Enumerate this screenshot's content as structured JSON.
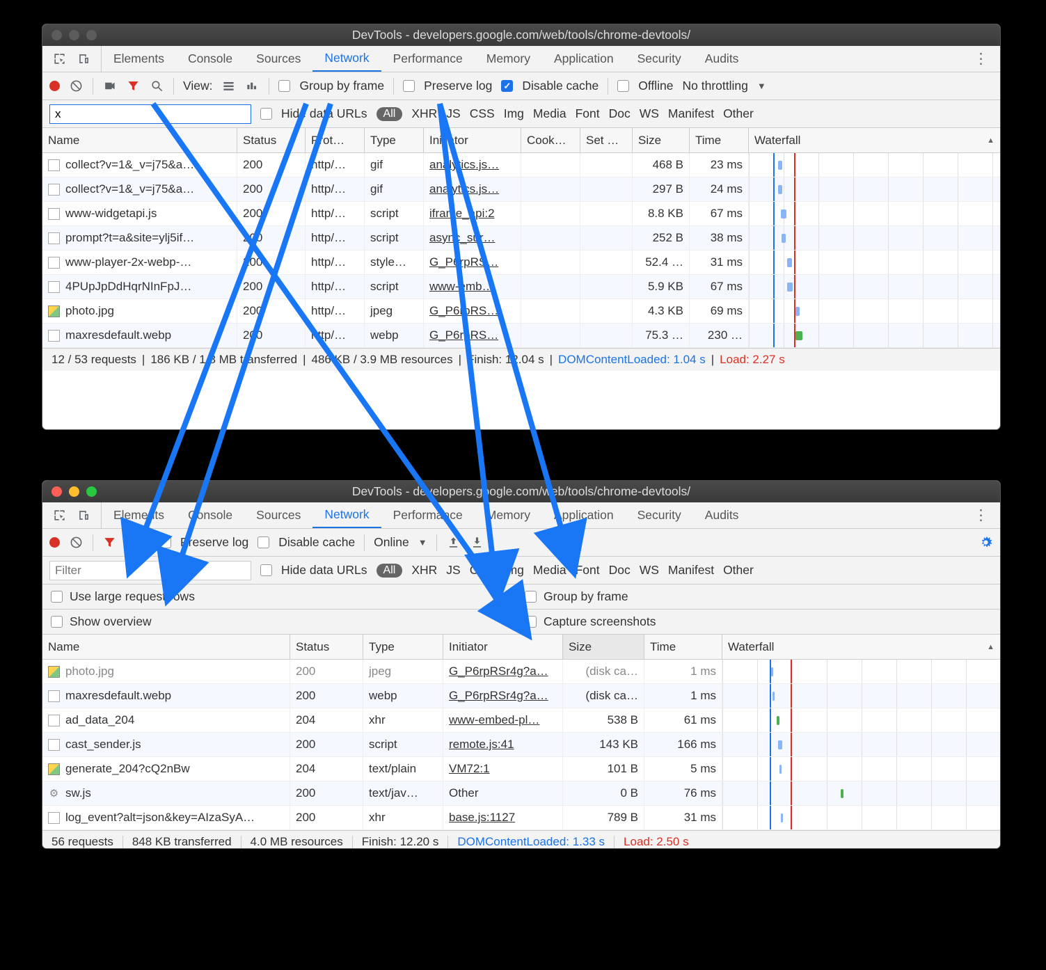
{
  "window_title": "DevTools - developers.google.com/web/tools/chrome-devtools/",
  "tabs": [
    "Elements",
    "Console",
    "Sources",
    "Network",
    "Performance",
    "Memory",
    "Application",
    "Security",
    "Audits"
  ],
  "active_tab": "Network",
  "toolbar1": {
    "view_label": "View:",
    "group_by_frame": "Group by frame",
    "preserve_log": "Preserve log",
    "disable_cache": "Disable cache",
    "offline": "Offline",
    "throttling": "No throttling"
  },
  "filter1": {
    "value": "x",
    "hide_data_urls": "Hide data URLs",
    "types": [
      "XHR",
      "JS",
      "CSS",
      "Img",
      "Media",
      "Font",
      "Doc",
      "WS",
      "Manifest",
      "Other"
    ],
    "all": "All"
  },
  "columns1": {
    "name": "Name",
    "status": "Status",
    "proto": "Prot…",
    "type": "Type",
    "initiator": "Initiator",
    "cook": "Cook…",
    "set": "Set …",
    "size": "Size",
    "time": "Time",
    "waterfall": "Waterfall"
  },
  "rows1": [
    {
      "name": "collect?v=1&_v=j75&a…",
      "status": "200",
      "proto": "http/…",
      "type": "gif",
      "initiator": "analytics.js…",
      "size": "468 B",
      "time": "23 ms",
      "wf": {
        "l": 42,
        "w": 6,
        "c": ""
      }
    },
    {
      "name": "collect?v=1&_v=j75&a…",
      "status": "200",
      "proto": "http/…",
      "type": "gif",
      "initiator": "analytics.js…",
      "size": "297 B",
      "time": "24 ms",
      "wf": {
        "l": 42,
        "w": 6,
        "c": ""
      }
    },
    {
      "name": "www-widgetapi.js",
      "status": "200",
      "proto": "http/…",
      "type": "script",
      "initiator": "iframe_api:2",
      "size": "8.8 KB",
      "time": "67 ms",
      "wf": {
        "l": 46,
        "w": 8,
        "c": ""
      }
    },
    {
      "name": "prompt?t=a&site=ylj5if…",
      "status": "200",
      "proto": "http/…",
      "type": "script",
      "initiator": "async_sur…",
      "size": "252 B",
      "time": "38 ms",
      "wf": {
        "l": 47,
        "w": 6,
        "c": ""
      }
    },
    {
      "name": "www-player-2x-webp-…",
      "status": "200",
      "proto": "http/…",
      "type": "style…",
      "initiator": "G_P6rpRS…",
      "size": "52.4 …",
      "time": "31 ms",
      "wf": {
        "l": 55,
        "w": 7,
        "c": ""
      }
    },
    {
      "name": "4PUpJpDdHqrNInFpJ…",
      "status": "200",
      "proto": "http/…",
      "type": "script",
      "initiator": "www-emb…",
      "size": "5.9 KB",
      "time": "67 ms",
      "wf": {
        "l": 55,
        "w": 8,
        "c": ""
      }
    },
    {
      "name": "photo.jpg",
      "status": "200",
      "proto": "http/…",
      "type": "jpeg",
      "initiator": "G_P6rpRS…",
      "size": "4.3 KB",
      "time": "69 ms",
      "wf": {
        "l": 67,
        "w": 6,
        "c": ""
      },
      "icon": "img"
    },
    {
      "name": "maxresdefault.webp",
      "status": "200",
      "proto": "http/…",
      "type": "webp",
      "initiator": "G_P6rpRS…",
      "size": "75.3 …",
      "time": "230 …",
      "wf": {
        "l": 67,
        "w": 10,
        "c": "g"
      }
    }
  ],
  "status1": {
    "requests": "12 / 53 requests",
    "transferred": "186 KB / 1.8 MB transferred",
    "resources": "486 KB / 3.9 MB resources",
    "finish": "Finish: 12.04 s",
    "dcl": "DOMContentLoaded: 1.04 s",
    "load": "Load: 2.27 s"
  },
  "toolbar2": {
    "preserve_log": "Preserve log",
    "disable_cache": "Disable cache",
    "online": "Online"
  },
  "filter2": {
    "placeholder": "Filter",
    "hide_data_urls": "Hide data URLs",
    "types": [
      "XHR",
      "JS",
      "CSS",
      "Img",
      "Media",
      "Font",
      "Doc",
      "WS",
      "Manifest",
      "Other"
    ],
    "all": "All"
  },
  "opts2": {
    "large_rows": "Use large request rows",
    "group_by_frame": "Group by frame",
    "show_overview": "Show overview",
    "capture_screenshots": "Capture screenshots"
  },
  "columns2": {
    "name": "Name",
    "status": "Status",
    "type": "Type",
    "initiator": "Initiator",
    "size": "Size",
    "time": "Time",
    "waterfall": "Waterfall"
  },
  "rows2": [
    {
      "name": "photo.jpg",
      "status": "200",
      "type": "jpeg",
      "initiator": "G_P6rpRSr4g?a…",
      "size": "(disk ca…",
      "time": "1 ms",
      "wf": {
        "l": 70,
        "w": 3
      },
      "grey": true,
      "icon": "img"
    },
    {
      "name": "maxresdefault.webp",
      "status": "200",
      "type": "webp",
      "initiator": "G_P6rpRSr4g?a…",
      "size": "(disk ca…",
      "time": "1 ms",
      "wf": {
        "l": 72,
        "w": 3
      }
    },
    {
      "name": "ad_data_204",
      "status": "204",
      "type": "xhr",
      "initiator": "www-embed-pl…",
      "size": "538 B",
      "time": "61 ms",
      "wf": {
        "l": 78,
        "w": 4,
        "c": "g"
      }
    },
    {
      "name": "cast_sender.js",
      "status": "200",
      "type": "script",
      "initiator": "remote.js:41",
      "size": "143 KB",
      "time": "166 ms",
      "wf": {
        "l": 80,
        "w": 6
      }
    },
    {
      "name": "generate_204?cQ2nBw",
      "status": "204",
      "type": "text/plain",
      "initiator": "VM72:1",
      "size": "101 B",
      "time": "5 ms",
      "wf": {
        "l": 82,
        "w": 3
      },
      "icon": "img"
    },
    {
      "name": "sw.js",
      "status": "200",
      "type": "text/jav…",
      "initiator": "Other",
      "size": "0 B",
      "time": "76 ms",
      "wf": {
        "l": 170,
        "w": 4,
        "c": "g"
      },
      "icon": "gear",
      "init_plain": true
    },
    {
      "name": "log_event?alt=json&key=AIzaSyA…",
      "status": "200",
      "type": "xhr",
      "initiator": "base.js:1127",
      "size": "789 B",
      "time": "31 ms",
      "wf": {
        "l": 84,
        "w": 3
      }
    }
  ],
  "status2": {
    "requests": "56 requests",
    "transferred": "848 KB transferred",
    "resources": "4.0 MB resources",
    "finish": "Finish: 12.20 s",
    "dcl": "DOMContentLoaded: 1.33 s",
    "load": "Load: 2.50 s"
  }
}
